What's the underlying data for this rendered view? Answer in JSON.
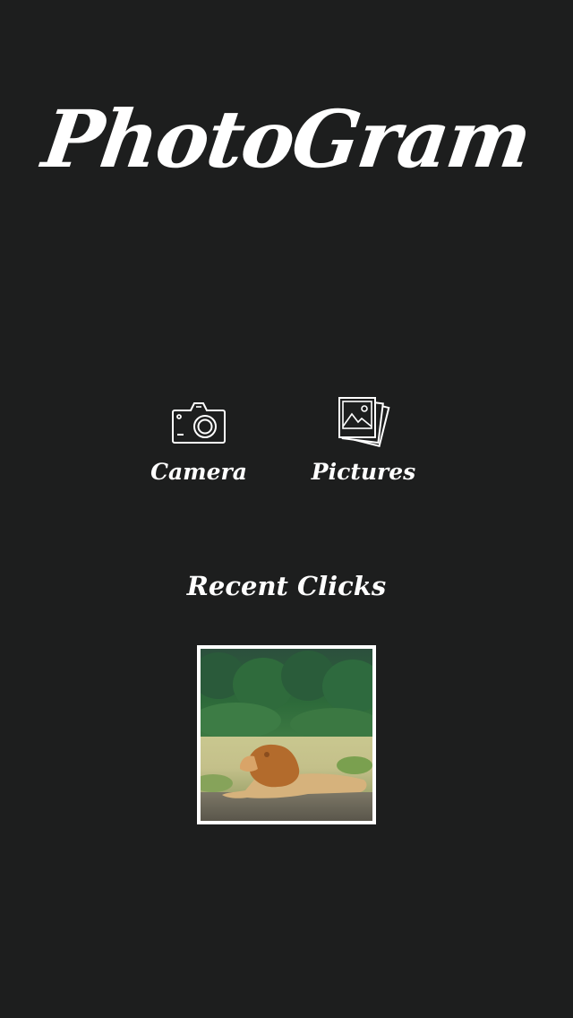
{
  "app": {
    "title": "PhotoGram"
  },
  "actions": [
    {
      "label": "Camera",
      "icon": "camera-icon"
    },
    {
      "label": "Pictures",
      "icon": "photo-stack-icon"
    }
  ],
  "recent": {
    "heading": "Recent Clicks",
    "items": [
      {
        "subject": "lion-photo-thumbnail"
      }
    ]
  },
  "colors": {
    "background": "#1d1e1e",
    "foreground": "#ffffff"
  }
}
